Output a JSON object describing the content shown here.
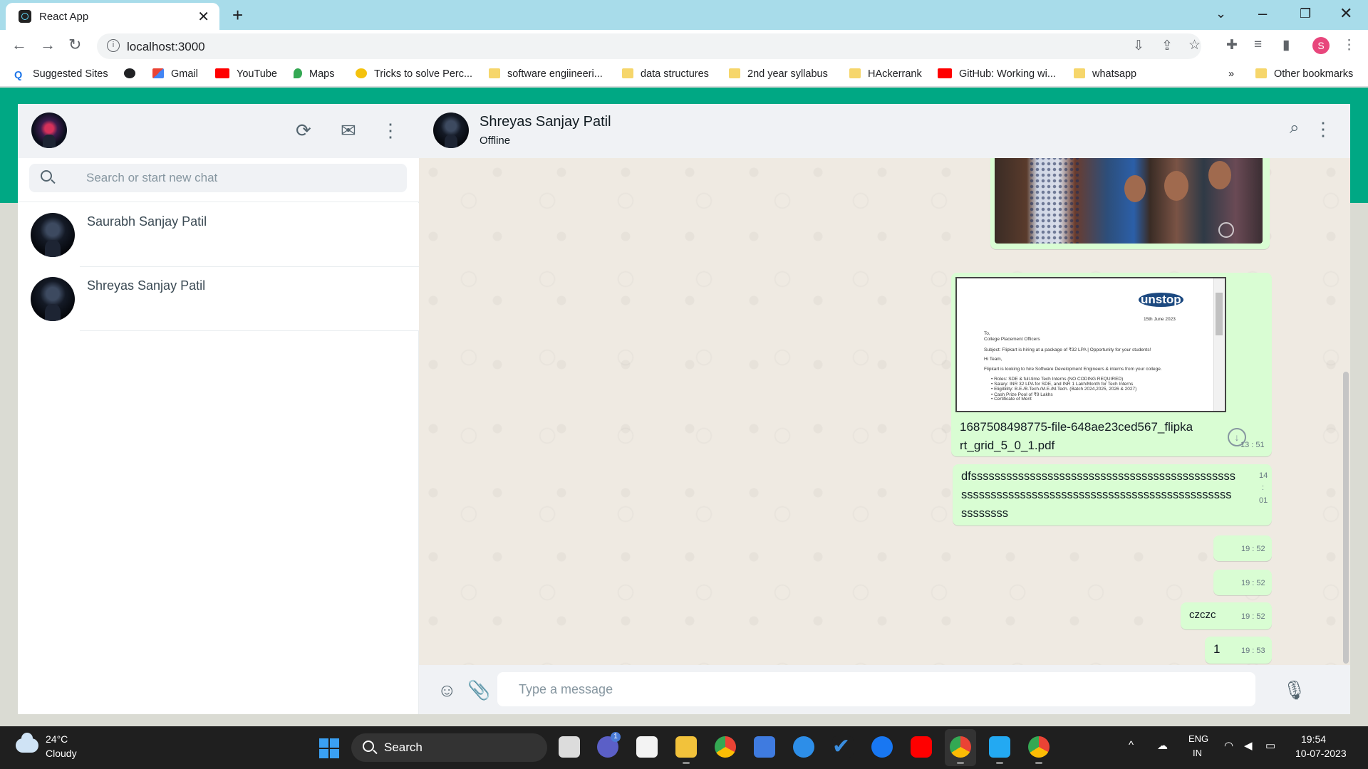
{
  "browser": {
    "tab_title": "React App",
    "url": "localhost:3000",
    "profile_initial": "S",
    "bookmarks": [
      {
        "label": "Suggested Sites",
        "icon": "search-icon"
      },
      {
        "label": "",
        "icon": "globe-icon"
      },
      {
        "label": "Gmail",
        "icon": "gmail-icon"
      },
      {
        "label": "YouTube",
        "icon": "youtube-icon"
      },
      {
        "label": "Maps",
        "icon": "maps-icon"
      },
      {
        "label": "Tricks to solve Perc...",
        "icon": "b-logo-icon"
      },
      {
        "label": "software engiineeri...",
        "icon": "folder-icon"
      },
      {
        "label": "data structures",
        "icon": "folder-icon"
      },
      {
        "label": "2nd  year syllabus",
        "icon": "folder-icon"
      },
      {
        "label": "HAckerrank",
        "icon": "folder-icon"
      },
      {
        "label": "GitHub: Working wi...",
        "icon": "youtube-icon"
      },
      {
        "label": "whatsapp",
        "icon": "folder-icon"
      }
    ],
    "overflow_label": "»",
    "other_bookmarks": "Other bookmarks"
  },
  "sidebar": {
    "search_placeholder": "Search or start new chat",
    "chats": [
      {
        "name": "Saurabh Sanjay Patil"
      },
      {
        "name": "Shreyas Sanjay Patil"
      }
    ]
  },
  "chat": {
    "contact_name": "Shreyas Sanjay Patil",
    "contact_status": "Offline",
    "pdf": {
      "brand": "unstop",
      "lines": [
        "15th June 2023",
        "To,",
        "College Placement Officers",
        "Subject: Flipkart is hiring at a package of ₹32 LPA | Opportunity for your students!",
        "Hi Team,",
        "Flipkart is looking to hire Software Development Engineers & interns from your college.",
        "• Roles: SDE & full-time Tech Interns (NO CODING REQUIRED)",
        "• Salary: INR 32 LPA for SDE, and INR 1 Lakh/Month for Tech Interns",
        "• Eligibility: B.E./B.Tech./M.E./M.Tech. (Batch 2024,2025, 2026 & 2027)",
        "• Cash Prize Pool of ₹9 Lakhs",
        "• Certificate of Merit"
      ]
    },
    "messages": [
      {
        "type": "image",
        "time": ""
      },
      {
        "type": "file",
        "text": "1687508498775-file-648ae23ced567_flipkart_grid_5_0_1.pdf",
        "time": "13 : 51"
      },
      {
        "type": "text",
        "text": "dfsssssssssssssssssssssssssssssssssssssssssssssssssssssssssssssssssssssssssssssssssssssssssssssssssss",
        "time_lines": [
          "14",
          ":",
          "01"
        ]
      },
      {
        "type": "text",
        "text": "",
        "time": "19 : 52"
      },
      {
        "type": "text",
        "text": "",
        "time": "19 : 52"
      },
      {
        "type": "text",
        "text": "czczc",
        "time": "19 : 52"
      },
      {
        "type": "text",
        "text": "1",
        "time": "19 : 53"
      }
    ],
    "composer_placeholder": "Type a message"
  },
  "taskbar": {
    "temperature": "24°C",
    "weather": "Cloudy",
    "search_label": "Search",
    "teams_badge": "1",
    "lang_top": "ENG",
    "lang_bottom": "IN",
    "time": "19:54",
    "date": "10-07-2023"
  },
  "colors": {
    "brand_green": "#00a884",
    "outgoing_bubble": "#d9fdd3",
    "chat_background": "#efeae2"
  }
}
